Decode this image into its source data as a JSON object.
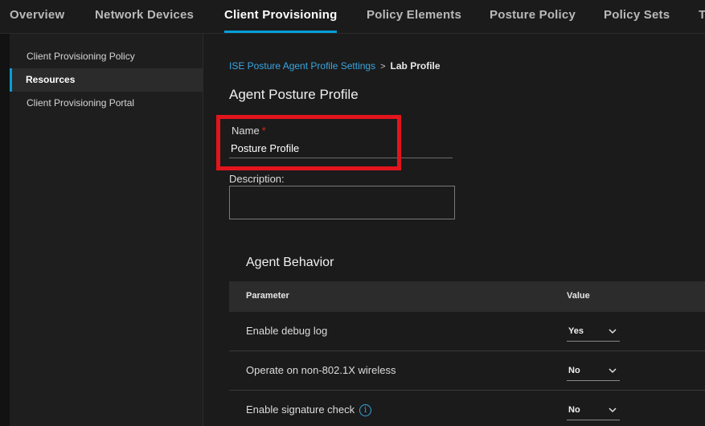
{
  "nav": {
    "tabs": [
      {
        "label": "Overview"
      },
      {
        "label": "Network Devices"
      },
      {
        "label": "Client Provisioning"
      },
      {
        "label": "Policy Elements"
      },
      {
        "label": "Posture Policy"
      },
      {
        "label": "Policy Sets"
      },
      {
        "label": "T"
      }
    ],
    "active_tab": "Client Provisioning",
    "accent_color": "#049fd9"
  },
  "sidebar": {
    "items": [
      {
        "label": "Client Provisioning Policy"
      },
      {
        "label": "Resources"
      },
      {
        "label": "Client Provisioning Portal"
      }
    ],
    "active_item": "Resources"
  },
  "breadcrumb": {
    "link": "ISE Posture Agent Profile Settings",
    "separator": ">",
    "current": "Lab Profile"
  },
  "page": {
    "title": "Agent Posture Profile"
  },
  "form": {
    "name_label": "Name",
    "name_required_marker": "*",
    "name_value": "Posture Profile",
    "description_label": "Description:",
    "description_value": "",
    "highlight_color": "#e2151c"
  },
  "agent_behavior": {
    "title": "Agent Behavior",
    "columns": {
      "parameter": "Parameter",
      "value": "Value"
    },
    "rows": [
      {
        "parameter": "Enable debug log",
        "value": "Yes",
        "info_icon": false
      },
      {
        "parameter": "Operate on non-802.1X wireless",
        "value": "No",
        "info_icon": false
      },
      {
        "parameter": "Enable signature check",
        "value": "No",
        "info_icon": true
      }
    ]
  },
  "icons": {
    "info": "info-icon",
    "chevron": "chevron-down-icon",
    "breadcrumb_separator": "chevron-right-icon"
  }
}
